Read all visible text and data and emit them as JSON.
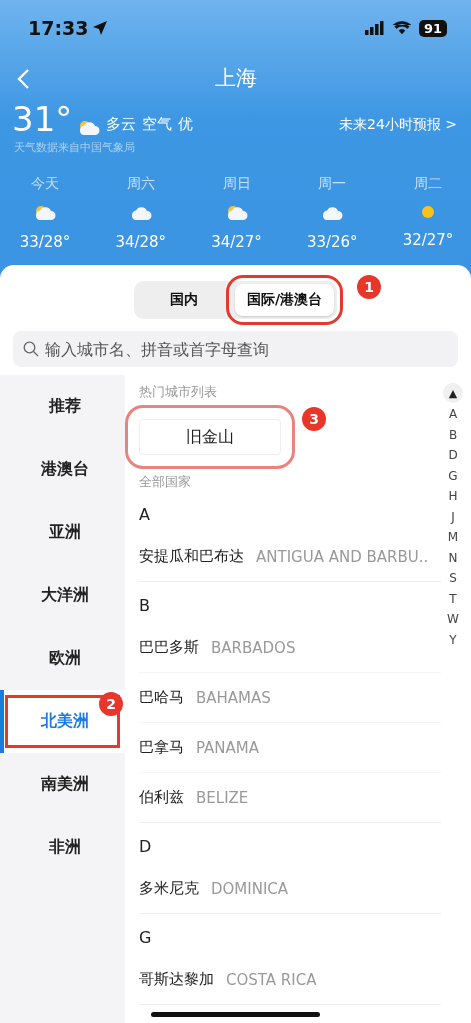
{
  "status_bar": {
    "time": "17:33",
    "battery": "91"
  },
  "header": {
    "title": "上海"
  },
  "current": {
    "temperature": "31°",
    "condition": "多云",
    "air_label": "空气",
    "air_quality": "优",
    "source": "天气数据来自中国气象局",
    "forecast_link": "未来24小时预报 >"
  },
  "forecast": [
    {
      "day": "今天",
      "kind": "partly",
      "temps": "33/28°"
    },
    {
      "day": "周六",
      "kind": "cloud",
      "temps": "34/28°"
    },
    {
      "day": "周日",
      "kind": "partly",
      "temps": "34/27°"
    },
    {
      "day": "周一",
      "kind": "cloud",
      "temps": "33/26°"
    },
    {
      "day": "周二",
      "kind": "sun",
      "temps": "32/27°"
    }
  ],
  "tabs": [
    {
      "label": "国内",
      "selected": false
    },
    {
      "label": "国际/港澳台",
      "selected": true,
      "annotation": "1"
    }
  ],
  "search": {
    "placeholder": "输入城市名、拼音或首字母查询"
  },
  "sidebar": {
    "items": [
      {
        "label": "推荐",
        "selected": false
      },
      {
        "label": "港澳台",
        "selected": false
      },
      {
        "label": "亚洲",
        "selected": false
      },
      {
        "label": "大洋洲",
        "selected": false
      },
      {
        "label": "欧洲",
        "selected": false
      },
      {
        "label": "北美洲",
        "selected": true,
        "annotation": "2"
      },
      {
        "label": "南美洲",
        "selected": false
      },
      {
        "label": "非洲",
        "selected": false
      }
    ]
  },
  "hot_cities": {
    "title": "热门城市列表",
    "cities": [
      {
        "name": "旧金山",
        "annotation": "3"
      }
    ]
  },
  "all_countries": {
    "title": "全部国家",
    "sections": [
      {
        "letter": "A",
        "rows": [
          {
            "name": "安提瓜和巴布达",
            "english": "ANTIGUA AND BARBU.."
          }
        ]
      },
      {
        "letter": "B",
        "rows": [
          {
            "name": "巴巴多斯",
            "english": "BARBADOS"
          },
          {
            "name": "巴哈马",
            "english": "BAHAMAS"
          },
          {
            "name": "巴拿马",
            "english": "PANAMA"
          },
          {
            "name": "伯利兹",
            "english": "BELIZE"
          }
        ]
      },
      {
        "letter": "D",
        "rows": [
          {
            "name": "多米尼克",
            "english": "DOMINICA"
          }
        ]
      },
      {
        "letter": "G",
        "rows": [
          {
            "name": "哥斯达黎加",
            "english": "COSTA RICA"
          }
        ]
      }
    ]
  },
  "index": {
    "top": "▲",
    "letters": [
      "A",
      "B",
      "D",
      "G",
      "H",
      "J",
      "M",
      "N",
      "S",
      "T",
      "W",
      "Y"
    ]
  }
}
